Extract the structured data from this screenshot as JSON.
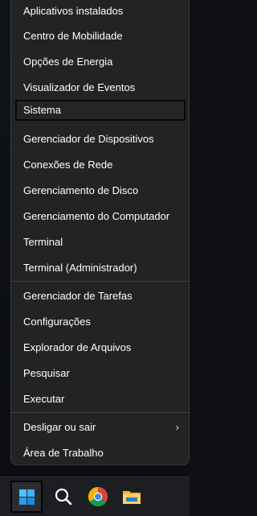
{
  "menu": {
    "items": [
      {
        "label": "Aplicativos instalados"
      },
      {
        "label": "Centro de Mobilidade"
      },
      {
        "label": "Opções de Energia"
      },
      {
        "label": "Visualizador de Eventos"
      },
      {
        "label": "Sistema",
        "selected": true
      },
      {
        "label": "Gerenciador de Dispositivos"
      },
      {
        "label": "Conexões de Rede"
      },
      {
        "label": "Gerenciamento de Disco"
      },
      {
        "label": "Gerenciamento do Computador"
      },
      {
        "label": "Terminal"
      },
      {
        "label": "Terminal (Administrador)"
      },
      {
        "label": "Gerenciador de Tarefas"
      },
      {
        "label": "Configurações"
      },
      {
        "label": "Explorador de Arquivos"
      },
      {
        "label": "Pesquisar"
      },
      {
        "label": "Executar"
      },
      {
        "label": "Desligar ou sair",
        "submenu_indicator": "›"
      },
      {
        "label": "Área de Trabalho"
      }
    ]
  },
  "taskbar": {
    "icons": [
      "windows-start-icon",
      "search-icon",
      "chrome-icon",
      "file-explorer-icon"
    ]
  },
  "colors": {
    "menu_background": "#232326",
    "text": "#ffffff",
    "windows_blue": "#3fa9f5"
  }
}
